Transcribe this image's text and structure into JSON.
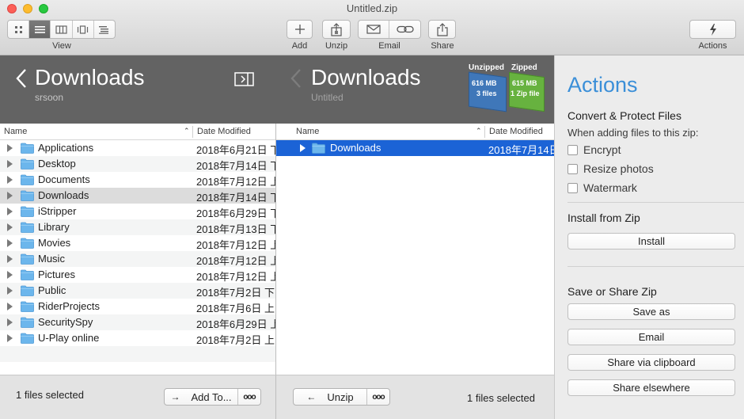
{
  "window": {
    "title": "Untitled.zip"
  },
  "toolbar": {
    "view_label": "View",
    "add_label": "Add",
    "unzip_label": "Unzip",
    "email_label": "Email",
    "share_label": "Share",
    "actions_label": "Actions"
  },
  "left": {
    "title": "Downloads",
    "subtitle": "srsoon",
    "col_name": "Name",
    "col_date": "Date Modified",
    "rows": [
      {
        "name": "Applications",
        "date": "2018年6月21日 下"
      },
      {
        "name": "Desktop",
        "date": "2018年7月14日 下"
      },
      {
        "name": "Documents",
        "date": "2018年7月12日 上"
      },
      {
        "name": "Downloads",
        "date": "2018年7月14日 下"
      },
      {
        "name": "iStripper",
        "date": "2018年6月29日 下"
      },
      {
        "name": "Library",
        "date": "2018年7月13日 下"
      },
      {
        "name": "Movies",
        "date": "2018年7月12日 上"
      },
      {
        "name": "Music",
        "date": "2018年7月12日 上"
      },
      {
        "name": "Pictures",
        "date": "2018年7月12日 上"
      },
      {
        "name": "Public",
        "date": "2018年7月2日 下"
      },
      {
        "name": "RiderProjects",
        "date": "2018年7月6日 上"
      },
      {
        "name": "SecuritySpy",
        "date": "2018年6月29日 上"
      },
      {
        "name": "U-Play online",
        "date": "2018年7月2日 上"
      }
    ],
    "status": "1 files selected",
    "add_to_label": "Add To...",
    "more_label": "ooo"
  },
  "right": {
    "title": "Downloads",
    "subtitle": "Untitled",
    "col_name": "Name",
    "col_date": "Date Modified",
    "rows": [
      {
        "name": "Downloads",
        "date": "2018年7月14日"
      }
    ],
    "status": "1 files selected",
    "unzip_label": "Unzip",
    "more_label": "ooo"
  },
  "badge": {
    "unzipped_label": "Unzipped",
    "zipped_label": "Zipped",
    "unzipped_size": "616 MB",
    "unzipped_files": "3 files",
    "zipped_size": "615 MB",
    "zipped_files": "1 Zip file"
  },
  "actions": {
    "title": "Actions",
    "convert_title": "Convert & Protect Files",
    "convert_sub": "When adding files to this zip:",
    "opt_encrypt": "Encrypt",
    "opt_resize": "Resize photos",
    "opt_watermark": "Watermark",
    "install_title": "Install from Zip",
    "install_btn": "Install",
    "save_title": "Save or Share Zip",
    "save_as_btn": "Save as",
    "email_btn": "Email",
    "clipboard_btn": "Share via clipboard",
    "elsewhere_btn": "Share elsewhere"
  },
  "colors": {
    "accent": "#3b8fd8",
    "selection": "#1b63d6",
    "folder": "#6cb6ec"
  }
}
